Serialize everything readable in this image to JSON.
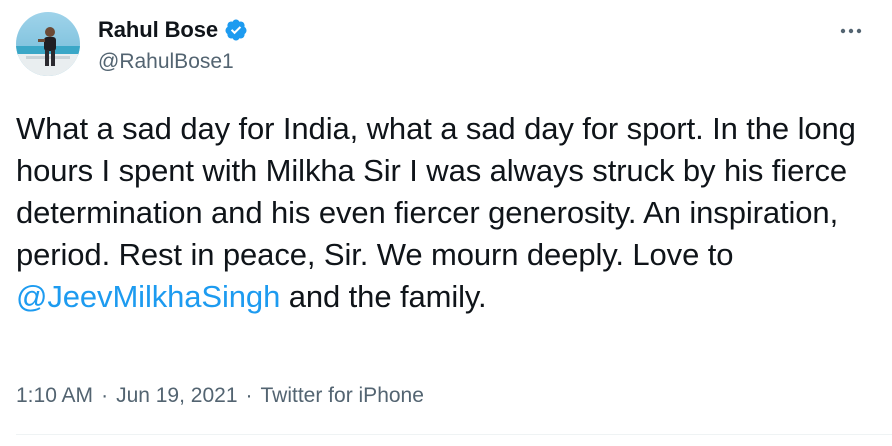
{
  "author": {
    "display_name": "Rahul Bose",
    "handle": "@RahulBose1",
    "verified": true,
    "verified_color": "#1d9bf0",
    "avatar_icon": "profile-photo"
  },
  "more_icon": "ellipsis-icon",
  "tweet": {
    "text_before_mention": "What a sad day for India, what a sad day for sport. In the long hours I spent with Milkha Sir I was always struck by his fierce determination and his even fiercer generosity. An inspiration, period. Rest in peace, Sir. We mourn deeply. Love to ",
    "mention": "@JeevMilkhaSingh",
    "text_after_mention": " and the family."
  },
  "meta": {
    "time": "1:10 AM",
    "separator": "·",
    "date": "Jun 19, 2021",
    "source": "Twitter for iPhone"
  },
  "colors": {
    "text": "#0f1419",
    "secondary": "#536471",
    "link": "#1d9bf0"
  }
}
